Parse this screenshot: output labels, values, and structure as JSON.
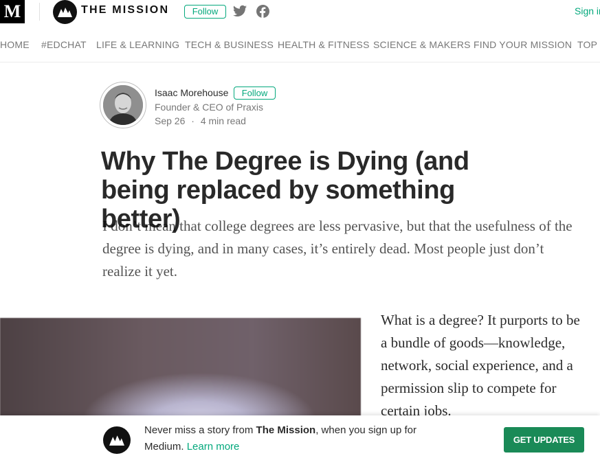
{
  "header": {
    "medium_logo": "M",
    "publication_name": "THE MISSION",
    "follow_label": "Follow",
    "signin_label": "Sign in",
    "icons": [
      "mission-logo-icon",
      "twitter-icon",
      "facebook-icon"
    ]
  },
  "nav": {
    "items": [
      "HOME",
      "#EDCHAT",
      "LIFE & LEARNING",
      "TECH & BUSINESS",
      "HEALTH & FITNESS",
      "SCIENCE & MAKERS",
      "FIND YOUR MISSION",
      "TOP STORIES"
    ]
  },
  "author": {
    "name": "Isaac Morehouse",
    "follow_label": "Follow",
    "bio": "Founder & CEO of Praxis",
    "date": "Sep 26",
    "separator": "·",
    "read_time": "4 min read"
  },
  "article": {
    "title": "Why The Degree is Dying (and being replaced by something better)",
    "subtitle": "I don’t mean that college degrees are less pervasive, but that the usefulness of the degree is dying, and in many cases, it’s entirely dead. Most people just don’t realize it yet.",
    "body": "What is a degree? It purports to be a bundle of goods—knowledge, network, social experience, and a permission slip to compete for certain jobs."
  },
  "banner": {
    "text_prefix": "Never miss a story from ",
    "publication": "The Mission",
    "text_suffix": ", when you sign up for Medium. ",
    "learn_more": "Learn more",
    "cta_label": "GET UPDATES"
  },
  "colors": {
    "accent_green": "#03a87c",
    "cta_green": "#1a8a57",
    "logo_black": "#111111"
  }
}
